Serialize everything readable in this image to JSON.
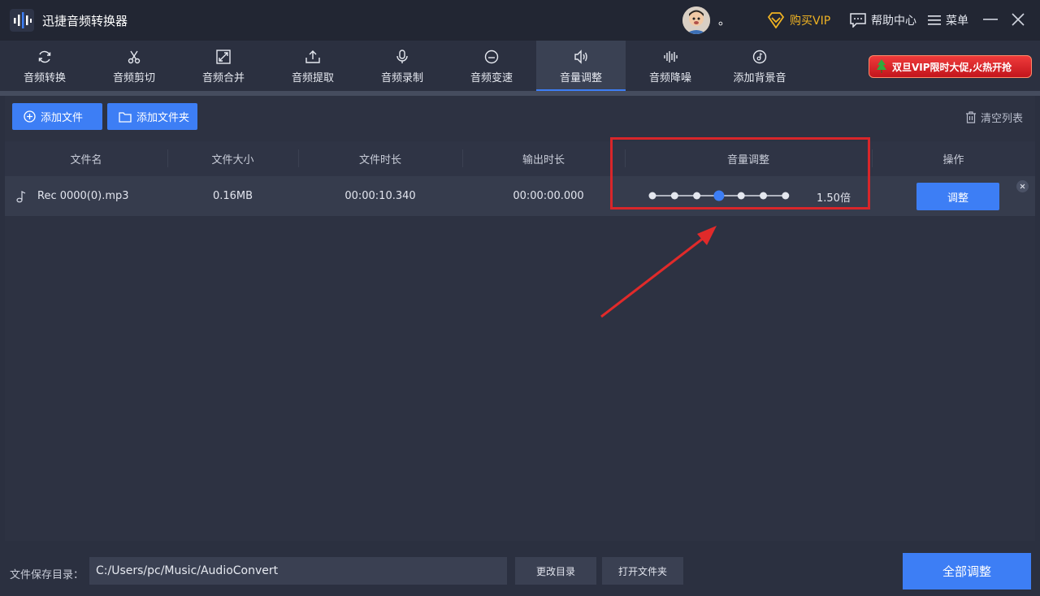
{
  "app": {
    "title": "迅捷音频转换器"
  },
  "user": {
    "name": "。"
  },
  "header": {
    "vip_label": "购买VIP",
    "help_label": "帮助中心",
    "menu_label": "菜单"
  },
  "toolbar": {
    "tabs": [
      {
        "label": "音频转换",
        "icon": "refresh-icon"
      },
      {
        "label": "音频剪切",
        "icon": "scissors-icon"
      },
      {
        "label": "音频合并",
        "icon": "merge-icon"
      },
      {
        "label": "音频提取",
        "icon": "upload-icon"
      },
      {
        "label": "音频录制",
        "icon": "microphone-icon"
      },
      {
        "label": "音频变速",
        "icon": "speed-icon"
      },
      {
        "label": "音量调整",
        "icon": "speaker-icon",
        "active": true
      },
      {
        "label": "音频降噪",
        "icon": "waveform-icon"
      },
      {
        "label": "添加背景音",
        "icon": "music-disc-icon"
      }
    ],
    "promo_text": "双旦VIP限时大促,火热开抢"
  },
  "actions": {
    "add_file": "添加文件",
    "add_folder": "添加文件夹",
    "clear_list": "清空列表"
  },
  "table": {
    "headers": {
      "name": "文件名",
      "size": "文件大小",
      "duration": "文件时长",
      "output_duration": "输出时长",
      "volume": "音量调整",
      "ops": "操作"
    },
    "rows": [
      {
        "name": "Rec 0000(0).mp3",
        "size": "0.16MB",
        "duration": "00:00:10.340",
        "output_duration": "00:00:00.000",
        "volume_text": "1.50倍",
        "volume_step": 4,
        "volume_steps": 7,
        "action": "调整"
      }
    ]
  },
  "footer": {
    "save_label": "文件保存目录：",
    "path": "C:/Users/pc/Music/AudioConvert",
    "change_dir": "更改目录",
    "open_folder": "打开文件夹",
    "adjust_all": "全部调整"
  },
  "colors": {
    "accent": "#3d7ef5",
    "vip": "#f0b323",
    "highlight": "#d8262a"
  }
}
